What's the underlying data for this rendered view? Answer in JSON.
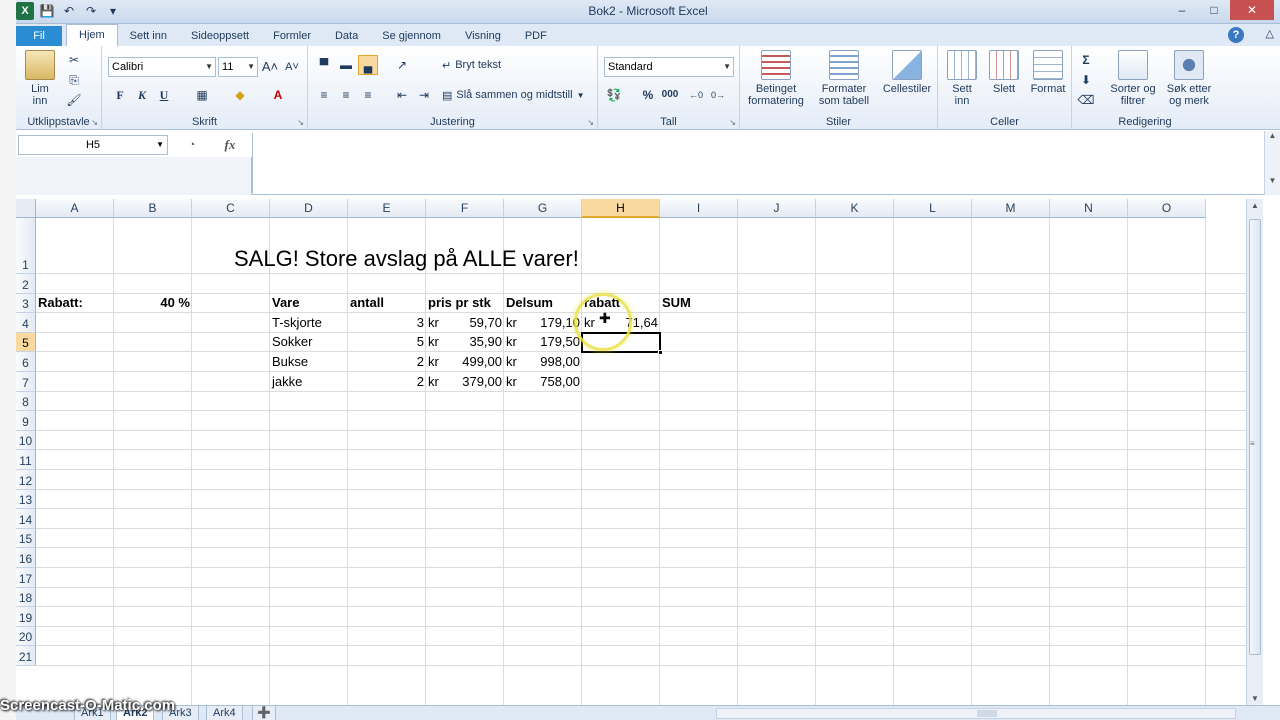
{
  "window": {
    "title": "Bok2  -  Microsoft Excel"
  },
  "ribbon_tabs": [
    "Fil",
    "Hjem",
    "Sett inn",
    "Sideoppsett",
    "Formler",
    "Data",
    "Se gjennom",
    "Visning",
    "PDF"
  ],
  "active_tab": "Hjem",
  "ribbon": {
    "clipboard": {
      "paste_label_1": "Lim",
      "paste_label_2": "inn",
      "group": "Utklippstavle"
    },
    "font": {
      "name": "Calibri",
      "size": "11",
      "group": "Skrift",
      "bold": "F",
      "italic": "K",
      "underline": "U"
    },
    "alignment": {
      "wrap": "Bryt tekst",
      "merge": "Slå sammen og midtstill",
      "group": "Justering"
    },
    "number": {
      "format": "Standard",
      "percent": "%",
      "thousands": "000",
      "group": "Tall"
    },
    "styles": {
      "cond_1": "Betinget",
      "cond_2": "formatering",
      "table_1": "Formater",
      "table_2": "som tabell",
      "cell_styles": "Cellestiler",
      "group": "Stiler"
    },
    "cells": {
      "insert_1": "Sett",
      "insert_2": "inn",
      "delete": "Slett",
      "format": "Format",
      "group": "Celler"
    },
    "editing": {
      "sort_1": "Sorter og",
      "sort_2": "filtrer",
      "find_1": "Søk etter",
      "find_2": "og merk",
      "group": "Redigering"
    }
  },
  "formula_bar": {
    "name_box": "H5",
    "fx": "fx",
    "formula": ""
  },
  "columns": [
    "A",
    "B",
    "C",
    "D",
    "E",
    "F",
    "G",
    "H",
    "I",
    "J",
    "K",
    "L",
    "M",
    "N",
    "O"
  ],
  "selected_column": "H",
  "rows": [
    "1",
    "2",
    "3",
    "4",
    "5",
    "6",
    "7",
    "8",
    "9",
    "10",
    "11",
    "12",
    "13",
    "14",
    "15",
    "16",
    "17",
    "18",
    "19",
    "20",
    "21"
  ],
  "selected_row": "5",
  "sheet": {
    "title": "SALG! Store avslag på ALLE varer!",
    "discount_label": "Rabatt:",
    "discount_value": "40 %",
    "headers": {
      "item": "Vare",
      "qty": "antall",
      "price": "pris pr stk",
      "subtotal": "Delsum",
      "discount": "rabatt",
      "sum": "SUM"
    },
    "currency": "kr",
    "items": [
      {
        "name": "T-skjorte",
        "qty": "3",
        "price": "59,70",
        "subtotal": "179,10",
        "discount": "71,64"
      },
      {
        "name": "Sokker",
        "qty": "5",
        "price": "35,90",
        "subtotal": "179,50",
        "discount": ""
      },
      {
        "name": "Bukse",
        "qty": "2",
        "price": "499,00",
        "subtotal": "998,00",
        "discount": ""
      },
      {
        "name": "jakke",
        "qty": "2",
        "price": "379,00",
        "subtotal": "758,00",
        "discount": ""
      }
    ]
  },
  "sheet_tabs": [
    "Ark1",
    "Ark2",
    "Ark3",
    "Ark4"
  ],
  "active_sheet": "Ark2",
  "watermark": "Screencast-O-Matic.com"
}
